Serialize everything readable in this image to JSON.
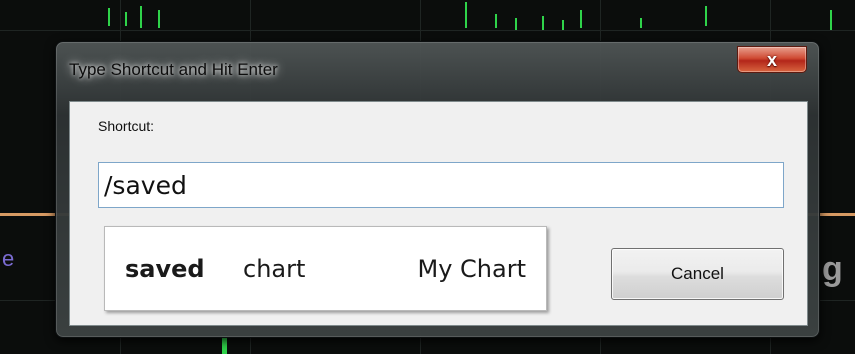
{
  "dialog": {
    "title": "Type Shortcut and Hit Enter",
    "close_label": "x",
    "shortcut_label": "Shortcut:",
    "shortcut_value": "/saved",
    "cancel_label": "Cancel"
  },
  "suggestion": {
    "keyword": "saved",
    "type": "chart",
    "name": "My Chart"
  },
  "background": {
    "left_letter": "e",
    "right_letter": "g"
  },
  "colors": {
    "close_button": "#c9402b",
    "input_border": "#7ea6c9",
    "chart_green": "#2fd34a",
    "chart_orange": "#d79a63"
  }
}
